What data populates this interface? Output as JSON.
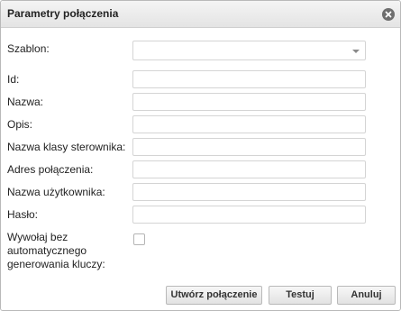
{
  "dialog": {
    "title": "Parametry połączenia",
    "close_icon": "close-circle-icon"
  },
  "form": {
    "template": {
      "label": "Szablon:",
      "value": ""
    },
    "id": {
      "label": "Id:",
      "value": ""
    },
    "name": {
      "label": "Nazwa:",
      "value": ""
    },
    "description": {
      "label": "Opis:",
      "value": ""
    },
    "driver_class": {
      "label": "Nazwa klasy sterownika:",
      "value": ""
    },
    "connection_address": {
      "label": "Adres połączenia:",
      "value": ""
    },
    "username": {
      "label": "Nazwa użytkownika:",
      "value": ""
    },
    "password": {
      "label": "Hasło:",
      "value": ""
    },
    "no_key_generation": {
      "label_lines": [
        "Wywołaj bez",
        "automatycznego",
        "generowania kluczy:"
      ],
      "checked": false
    }
  },
  "buttons": {
    "create": "Utwórz połączenie",
    "test": "Testuj",
    "cancel": "Anuluj"
  }
}
